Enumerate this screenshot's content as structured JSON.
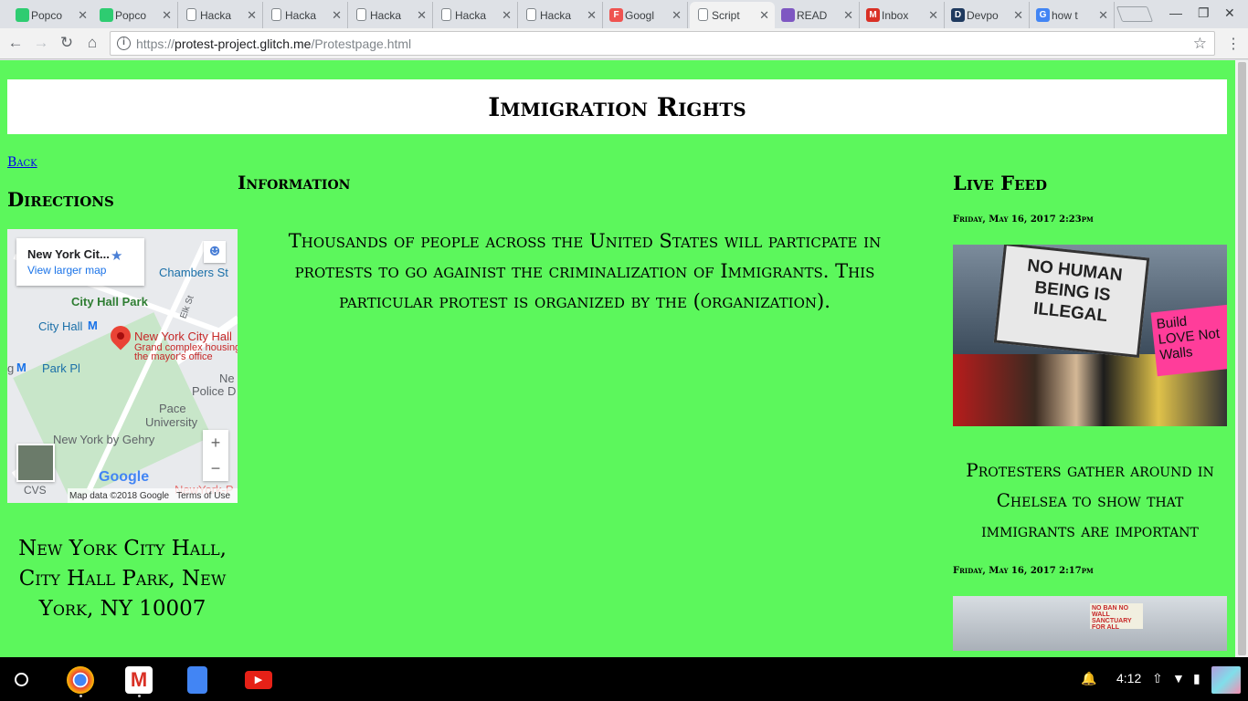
{
  "browser": {
    "tabs": [
      {
        "label": "Popco",
        "favicon": "popcorn-icon",
        "color": "#2ecc71"
      },
      {
        "label": "Popco",
        "favicon": "popcorn-icon",
        "color": "#2ecc71"
      },
      {
        "label": "Hacka",
        "favicon": "page-icon"
      },
      {
        "label": "Hacka",
        "favicon": "page-icon"
      },
      {
        "label": "Hacka",
        "favicon": "page-icon"
      },
      {
        "label": "Hacka",
        "favicon": "page-icon"
      },
      {
        "label": "Hacka",
        "favicon": "page-icon"
      },
      {
        "label": "Googl",
        "favicon": "forms-icon",
        "color": "#ef5350",
        "letter": "F"
      },
      {
        "label": "Script",
        "favicon": "page-icon",
        "active": true
      },
      {
        "label": "READ",
        "favicon": "readme-icon",
        "color": "#7e57c2"
      },
      {
        "label": "Inbox",
        "favicon": "gmail-icon",
        "color": "#d93025",
        "letter": "M"
      },
      {
        "label": "Devpo",
        "favicon": "devpost-icon",
        "color": "#1f3a5f",
        "letter": "D"
      },
      {
        "label": "how t",
        "favicon": "google-icon",
        "color": "#4285f4",
        "letter": "G"
      }
    ],
    "url_scheme": "https://",
    "url_host": "protest-project.glitch.me",
    "url_path": "/Protestpage.html"
  },
  "page": {
    "title": "Immigration Rights",
    "back_link": "Back",
    "directions_heading": "Directions",
    "information_heading": "Information",
    "live_feed_heading": "Live Feed",
    "information_text": "Thousands of people across the United States will particpate in protests to go againist the criminalization of Immigrants. This particular protest is organized by the (organization).",
    "address": "New York City Hall, City Hall Park, New York, NY 10007"
  },
  "map": {
    "card_place": "New York Cit...",
    "card_link": "View larger map",
    "labels": {
      "chambers": "Chambers St",
      "city_hall_park": "City Hall Park",
      "city_hall_station": "City Hall",
      "nych": "New York City Hall",
      "nych_sub1": "Grand complex housing",
      "nych_sub2": "the mayor's office",
      "park_pl": "Park Pl",
      "pace": "Pace",
      "university": "University",
      "police": "Police D",
      "ne": "Ne",
      "gehry": "New York by Gehry",
      "cvs": "CVS",
      "elk": "Elk St",
      "newyork_p": "NewYork-P",
      "g": "g",
      "google": "Google"
    },
    "map_data": "Map data ©2018 Google",
    "terms": "Terms of Use",
    "zoom_in": "+",
    "zoom_out": "−"
  },
  "feed": {
    "posts": [
      {
        "date": "Friday, May 16, 2017 2:23pm",
        "sign_text": "NO HUMAN BEING IS ILLEGAL",
        "sign2_text": "Build LOVE Not Walls",
        "caption": "Protesters gather around in Chelsea to show that immigrants are important"
      },
      {
        "date": "Friday, May 16, 2017 2:17pm",
        "sign_text": "NO BAN NO WALL SANCTUARY FOR ALL"
      }
    ]
  },
  "shelf": {
    "time": "4:12",
    "apps": [
      "chrome-icon",
      "gmail-icon",
      "docs-icon",
      "youtube-icon"
    ]
  }
}
